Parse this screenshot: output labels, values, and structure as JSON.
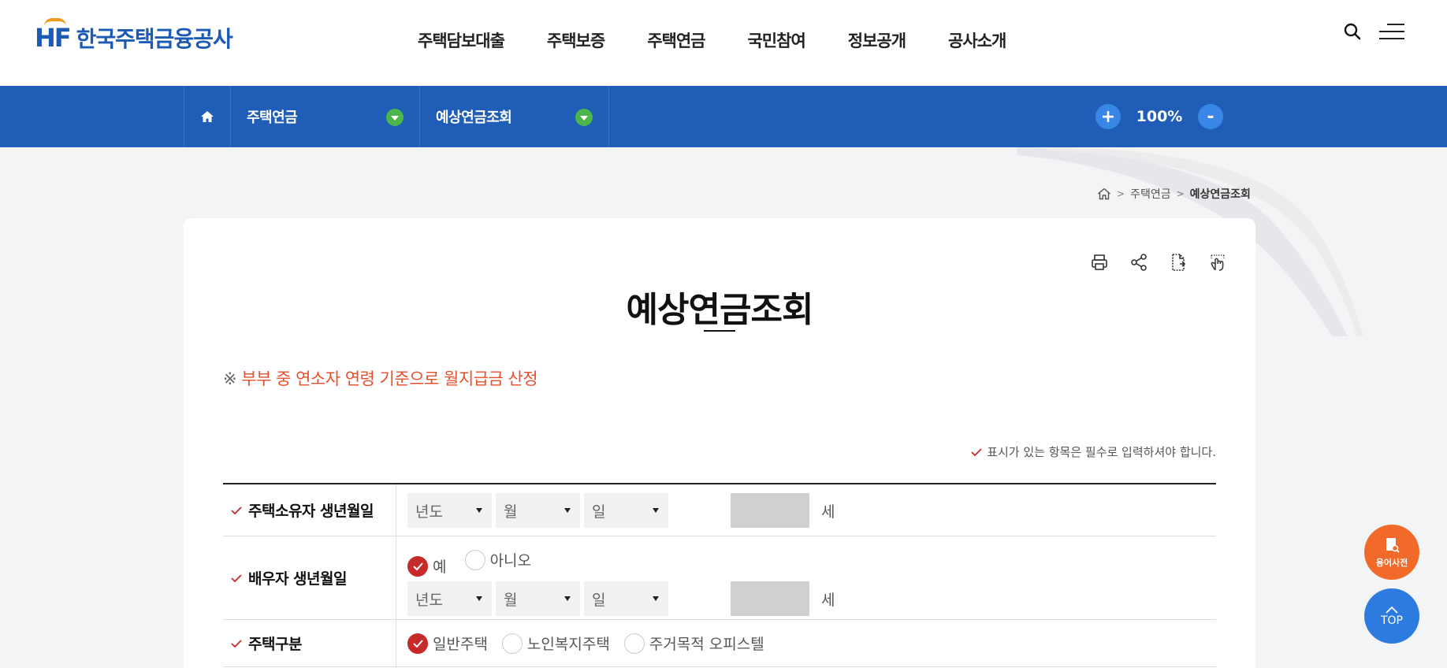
{
  "header": {
    "logo_mark": "HF",
    "logo_text": "한국주택금융공사",
    "nav": [
      "주택담보대출",
      "주택보증",
      "주택연금",
      "국민참여",
      "정보공개",
      "공사소개"
    ]
  },
  "subbar": {
    "menu1": "주택연금",
    "menu2": "예상연금조회",
    "zoom_in": "+",
    "zoom_value": "100%",
    "zoom_out": "-"
  },
  "breadcrumb": {
    "items": [
      "주택연금",
      "예상연금조회"
    ],
    "separator": ">"
  },
  "page": {
    "title": "예상연금조회",
    "notice_mark": "※",
    "notice_text": "부부 중 연소자 연령 기준으로 월지급금 산정",
    "required_note": "표시가 있는 항목은 필수로 입력하셔야 합니다."
  },
  "form": {
    "owner_birth": {
      "label": "주택소유자 생년월일",
      "year_placeholder": "년도",
      "month_placeholder": "월",
      "day_placeholder": "일",
      "age_unit": "세"
    },
    "spouse_birth": {
      "label": "배우자 생년월일",
      "option_yes": "예",
      "option_no": "아니오",
      "selected": "예",
      "year_placeholder": "년도",
      "month_placeholder": "월",
      "day_placeholder": "일",
      "age_unit": "세"
    },
    "house_type": {
      "label": "주택구분",
      "options": [
        "일반주택",
        "노인복지주택",
        "주거목적 오피스텔"
      ],
      "selected": "일반주택"
    }
  },
  "floating": {
    "dict_label": "용어사전",
    "top_label": "TOP"
  },
  "colors": {
    "brand_blue": "#1f5db6",
    "accent_red": "#c62a2a",
    "notice_orange": "#e4502b",
    "dropdown_green": "#4bb649",
    "fab_orange": "#f26a2a",
    "fab_blue": "#2e7be0"
  },
  "icons": [
    "search-icon",
    "menu-icon",
    "home-icon",
    "print-icon",
    "share-icon",
    "document-icon",
    "touch-icon",
    "check-icon",
    "book-search-icon",
    "chevron-up-icon"
  ]
}
